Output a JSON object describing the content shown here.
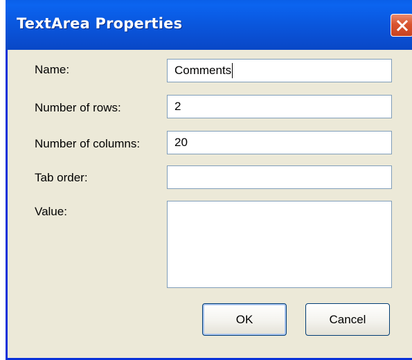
{
  "window": {
    "title": "TextArea Properties",
    "close_icon": "close-icon"
  },
  "form": {
    "name": {
      "label": "Name:",
      "value": "Comments"
    },
    "rows": {
      "label": "Number of rows:",
      "value": "2"
    },
    "columns": {
      "label": "Number of columns:",
      "value": "20"
    },
    "tab_order": {
      "label": "Tab order:",
      "value": ""
    },
    "value": {
      "label": "Value:",
      "value": ""
    }
  },
  "buttons": {
    "ok": "OK",
    "cancel": "Cancel"
  },
  "colors": {
    "titlebar": "#0a58df",
    "dialog_bg": "#ece9d8",
    "close_button": "#d9552f",
    "field_border": "#7f9db9"
  }
}
